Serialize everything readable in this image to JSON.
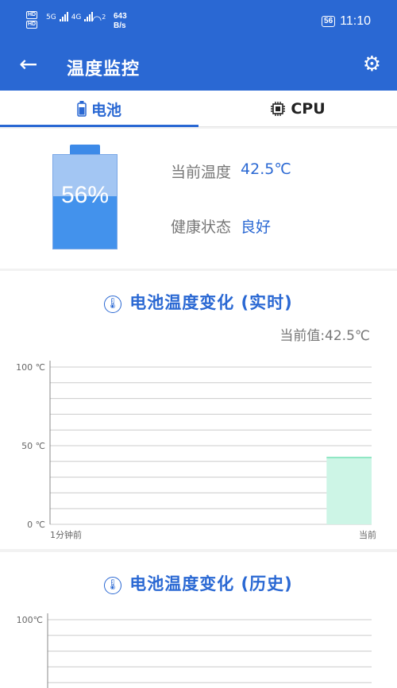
{
  "status_bar": {
    "hd1": "HD",
    "hd2": "HD",
    "sig1_type": "5G",
    "sig2_type": "4G",
    "wifi_sub": "2",
    "speed_value": "643",
    "speed_unit": "B/s",
    "battery_level": "56",
    "time": "11:10"
  },
  "app_bar": {
    "title": "温度监控"
  },
  "tabs": [
    {
      "label": "电池",
      "icon": "battery-icon",
      "active": true
    },
    {
      "label": "CPU",
      "icon": "cpu-icon",
      "active": false
    }
  ],
  "battery_status": {
    "percent_text": "56%",
    "level": 0.56,
    "temp_label": "当前温度",
    "temp_value": "42.5℃",
    "health_label": "健康状态",
    "health_value": "良好"
  },
  "live_chart": {
    "title": "电池温度变化 (实时)",
    "current_value": "当前值:42.5℃"
  },
  "history_chart": {
    "title": "电池温度变化 (历史)"
  },
  "colors": {
    "primary": "#2a68d3",
    "battery_fill": "#4392ec",
    "battery_empty": "#a3c6f3",
    "area_fill": "#cdf5e6",
    "area_line": "#8ee6c2",
    "grid": "#cccccc"
  },
  "chart_data": [
    {
      "type": "area",
      "title": "电池温度变化 (实时)",
      "y_tick_labels": [
        "100 ℃",
        "50 ℃",
        "0 ℃"
      ],
      "y_ticks": [
        100,
        50,
        0
      ],
      "ylim": [
        0,
        100
      ],
      "x_tick_labels": [
        "1分钟前",
        "当前"
      ],
      "grid": true,
      "series": [
        {
          "x_start_fraction": 0.86,
          "x_end_fraction": 1.0,
          "value": 42.5
        }
      ]
    },
    {
      "type": "area",
      "title": "电池温度变化 (历史)",
      "y_tick_labels": [
        "100℃"
      ],
      "y_ticks": [
        100
      ],
      "ylim": [
        0,
        100
      ],
      "grid": true,
      "series": []
    }
  ]
}
